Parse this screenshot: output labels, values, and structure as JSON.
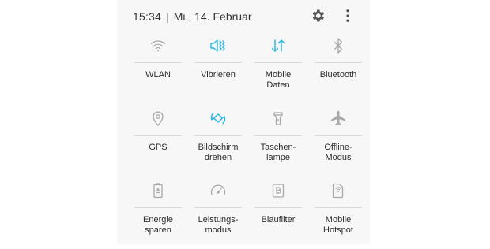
{
  "status_bar": {
    "time": "15:34",
    "separator": "|",
    "date": "Mi., 14. Februar"
  },
  "colors": {
    "active": "#2ab8e3",
    "inactive": "#a9a9a9",
    "panel": "#f7f7f7"
  },
  "tiles": [
    {
      "label": "WLAN",
      "icon": "wifi-icon",
      "active": false
    },
    {
      "label": "Vibrieren",
      "icon": "vibrate-icon",
      "active": true
    },
    {
      "label": "Mobile\nDaten",
      "icon": "mobile-data-icon",
      "active": true
    },
    {
      "label": "Bluetooth",
      "icon": "bluetooth-icon",
      "active": false
    },
    {
      "label": "GPS",
      "icon": "location-pin-icon",
      "active": false
    },
    {
      "label": "Bildschirm\ndrehen",
      "icon": "rotate-screen-icon",
      "active": true
    },
    {
      "label": "Taschen-\nlampe",
      "icon": "flashlight-icon",
      "active": false
    },
    {
      "label": "Offline-\nModus",
      "icon": "airplane-icon",
      "active": false
    },
    {
      "label": "Energie\nsparen",
      "icon": "battery-saver-icon",
      "active": false
    },
    {
      "label": "Leistungs-\nmodus",
      "icon": "speedometer-icon",
      "active": false
    },
    {
      "label": "Blaufilter",
      "icon": "blue-light-filter-icon",
      "active": false
    },
    {
      "label": "Mobile\nHotspot",
      "icon": "hotspot-icon",
      "active": false
    }
  ]
}
